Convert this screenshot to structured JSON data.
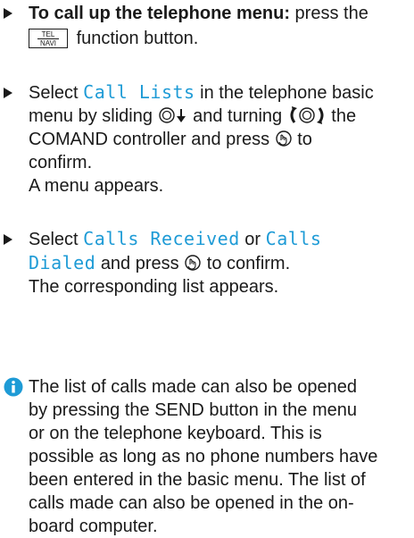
{
  "steps": [
    {
      "bold": "To call up the telephone menu:",
      "l1_rest": "press the",
      "button_top": "TEL",
      "button_bottom": "NAVI",
      "l2_rest": "function button."
    },
    {
      "l1_pre": "Select",
      "code": "Call Lists",
      "l1_post": "in the telephone basic",
      "l2_a": "menu by sliding",
      "l2_b": "and turning",
      "l2_c": "the",
      "l3_a": "COMAND controller and press",
      "l3_b": "to",
      "l4": "confirm.",
      "result": "A menu appears."
    },
    {
      "l1_pre": "Select",
      "code1": "Calls Received",
      "l1_mid": "or",
      "code2a": "Calls",
      "code2b": "Dialed",
      "l2_post": "and press",
      "l2_end": "to confirm.",
      "result": "The corresponding list appears."
    }
  ],
  "note": {
    "icon": "info-icon",
    "lines": [
      "The list of calls made can also be opened",
      "by pressing the SEND button in the menu",
      "or on the telephone keyboard. This is",
      "possible as long as no phone numbers have",
      "been entered in the basic menu. The list of",
      "calls made can also be opened in the on-",
      "board computer."
    ]
  },
  "colors": {
    "accent": "#1e9bd6",
    "text": "#1a1a1a"
  }
}
